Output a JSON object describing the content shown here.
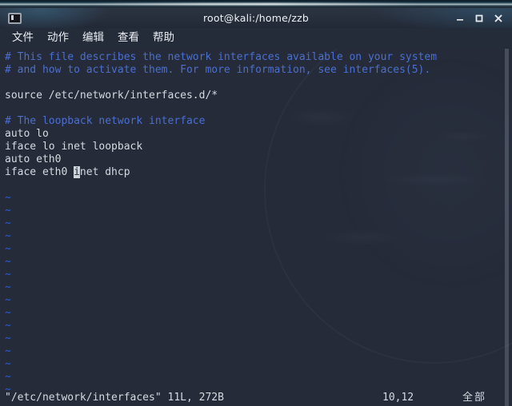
{
  "window": {
    "title": "root@kali:/home/zzb",
    "icon": "terminal-icon",
    "controls": {
      "minimize": "minimize-icon",
      "maximize": "maximize-icon",
      "close": "close-icon"
    }
  },
  "menubar": {
    "items": [
      {
        "label": "文件"
      },
      {
        "label": "动作"
      },
      {
        "label": "编辑"
      },
      {
        "label": "查看"
      },
      {
        "label": "帮助"
      }
    ]
  },
  "editor": {
    "application": "vim",
    "lines": [
      {
        "text": "# This file describes the network interfaces available on your system",
        "style": "comment"
      },
      {
        "text": "# and how to activate them. For more information, see interfaces(5).",
        "style": "comment"
      },
      {
        "text": "",
        "style": "empty"
      },
      {
        "text": "source /etc/network/interfaces.d/*",
        "style": "text"
      },
      {
        "text": "",
        "style": "empty"
      },
      {
        "text": "# The loopback network interface",
        "style": "comment"
      },
      {
        "text": "auto lo",
        "style": "text"
      },
      {
        "text": "iface lo inet loopback",
        "style": "text"
      },
      {
        "text": "auto eth0",
        "style": "text"
      },
      {
        "text": "iface eth0 ",
        "style": "text",
        "cursor_char": "i",
        "text_after": "net dhcp"
      },
      {
        "text": "",
        "style": "empty"
      }
    ],
    "tilde_char": "~",
    "tilde_count": 16,
    "cursor": {
      "char": "i",
      "line": 10,
      "column": 12
    }
  },
  "statusline": {
    "file": "\"/etc/network/interfaces\" 11L, 272B",
    "position": "10,12",
    "percent": "全部"
  },
  "colors": {
    "comment": "#4a6fd0",
    "text": "#d5dae0",
    "tilde": "#2b5fe0",
    "background": "#252b39",
    "titlebar": "#262d3b",
    "cursor": "#cfd5db"
  }
}
